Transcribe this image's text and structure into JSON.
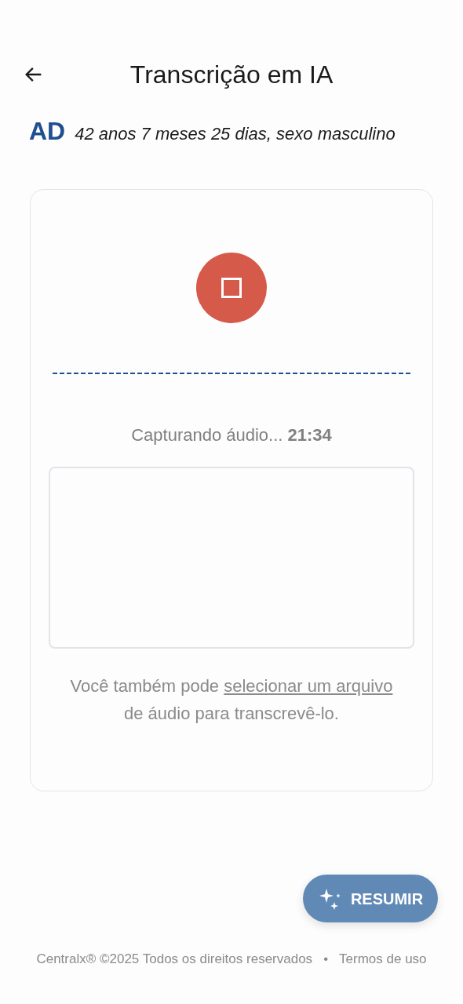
{
  "header": {
    "title": "Transcrição em IA"
  },
  "patient": {
    "initials": "AD",
    "details": "42 anos 7 meses 25 dias, sexo masculino"
  },
  "recorder": {
    "recording": true,
    "status": "Capturando áudio... **21:34**",
    "help": {
      "before": "Você também pode",
      "link": "selecionar um arquivo",
      "after": "de áudio para transcrevê-lo."
    }
  },
  "summarize_button": {
    "label": "RESUMIR"
  },
  "footer": {
    "copyright": "Centralx® ©2025 Todos os direitos reservados",
    "separator": "•",
    "terms": "Termos de uso"
  }
}
